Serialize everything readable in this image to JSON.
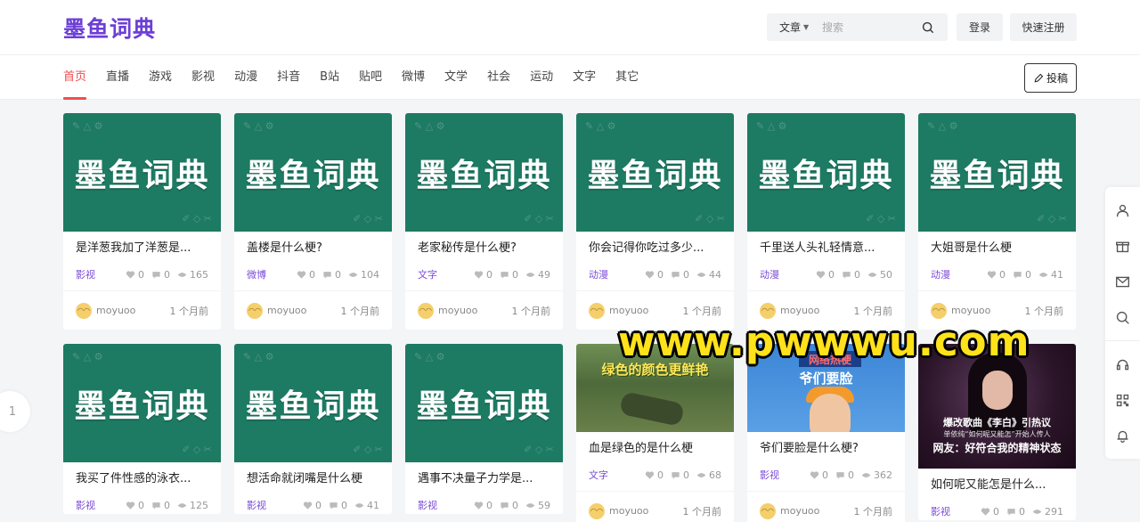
{
  "header": {
    "logo": "墨鱼词典",
    "search": {
      "type_label": "文章",
      "placeholder": "搜索"
    },
    "login_label": "登录",
    "register_label": "快速注册",
    "submit_label": "投稿"
  },
  "nav": [
    {
      "label": "首页",
      "active": true
    },
    {
      "label": "直播"
    },
    {
      "label": "游戏"
    },
    {
      "label": "影视"
    },
    {
      "label": "动漫"
    },
    {
      "label": "抖音"
    },
    {
      "label": "B站"
    },
    {
      "label": "贴吧"
    },
    {
      "label": "微博"
    },
    {
      "label": "文学"
    },
    {
      "label": "社会"
    },
    {
      "label": "运动"
    },
    {
      "label": "文字"
    },
    {
      "label": "其它"
    }
  ],
  "thumb_logo_text": "墨鱼词典",
  "cards_row1": [
    {
      "title": "是洋葱我加了洋葱是...",
      "category": "影视",
      "likes": "0",
      "comments": "0",
      "views": "165",
      "author": "moyuoo",
      "time": "1 个月前"
    },
    {
      "title": "盖楼是什么梗?",
      "category": "微博",
      "likes": "0",
      "comments": "0",
      "views": "104",
      "author": "moyuoo",
      "time": "1 个月前"
    },
    {
      "title": "老家秘传是什么梗?",
      "category": "文字",
      "likes": "0",
      "comments": "0",
      "views": "49",
      "author": "moyuoo",
      "time": "1 个月前"
    },
    {
      "title": "你会记得你吃过多少...",
      "category": "动漫",
      "likes": "0",
      "comments": "0",
      "views": "44",
      "author": "moyuoo",
      "time": "1 个月前"
    },
    {
      "title": "千里送人头礼轻情意...",
      "category": "动漫",
      "likes": "0",
      "comments": "0",
      "views": "50",
      "author": "moyuoo",
      "time": "1 个月前"
    },
    {
      "title": "大姐哥是什么梗",
      "category": "动漫",
      "likes": "0",
      "comments": "0",
      "views": "41",
      "author": "moyuoo",
      "time": "1 个月前"
    }
  ],
  "cards_row2": [
    {
      "title": "我买了件性感的泳衣...",
      "category": "影视",
      "likes": "0",
      "comments": "0",
      "views": "125"
    },
    {
      "title": "想活命就闭嘴是什么梗",
      "category": "影视",
      "likes": "0",
      "comments": "0",
      "views": "41"
    },
    {
      "title": "遇事不决量子力学是...",
      "category": "影视",
      "likes": "0",
      "comments": "0",
      "views": "59"
    },
    {
      "title": "血是绿色的是什么梗",
      "category": "文字",
      "likes": "0",
      "comments": "0",
      "views": "68",
      "author": "moyuoo",
      "time": "1 个月前",
      "thumb_caption": "绿色的颜色更鲜艳"
    },
    {
      "title": "爷们要脸是什么梗?",
      "category": "影视",
      "likes": "0",
      "comments": "0",
      "views": "362",
      "author": "moyuoo",
      "time": "1 个月前",
      "thumb_tag": "网络热梗",
      "thumb_caption": "爷们要脸"
    },
    {
      "title": "如何呢又能怎是什么...",
      "category": "影视",
      "likes": "0",
      "comments": "0",
      "views": "291",
      "thumb_caption1": "爆改歌曲《李白》引热议",
      "thumb_caption2": "单依纯“如何呢又能怎”开始人传人",
      "thumb_caption3": "网友：好符合我的精神状态"
    }
  ],
  "pager": "1",
  "watermark": "www.pwwwu.com"
}
